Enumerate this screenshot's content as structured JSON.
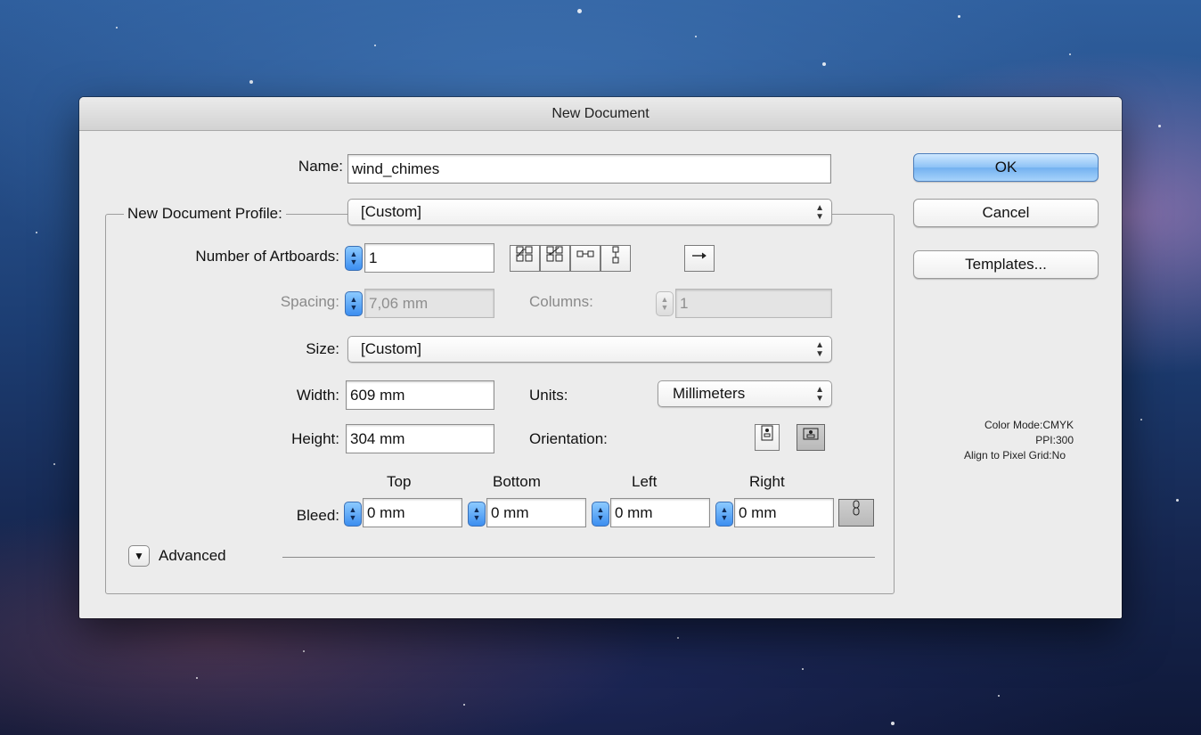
{
  "dialog": {
    "title": "New Document"
  },
  "name": {
    "label": "Name:",
    "value": "wind_chimes"
  },
  "profile": {
    "label": "New Document Profile:",
    "value": "[Custom]"
  },
  "artboards": {
    "label": "Number of Artboards:",
    "value": "1"
  },
  "spacing": {
    "label": "Spacing:",
    "value": "7,06 mm"
  },
  "columns": {
    "label": "Columns:",
    "value": "1"
  },
  "size": {
    "label": "Size:",
    "value": "[Custom]"
  },
  "width": {
    "label": "Width:",
    "value": "609 mm"
  },
  "height": {
    "label": "Height:",
    "value": "304 mm"
  },
  "units": {
    "label": "Units:",
    "value": "Millimeters"
  },
  "orientation": {
    "label": "Orientation:",
    "selected": "landscape"
  },
  "bleed": {
    "label": "Bleed:",
    "headers": [
      "Top",
      "Bottom",
      "Left",
      "Right"
    ],
    "values": [
      "0 mm",
      "0 mm",
      "0 mm",
      "0 mm"
    ]
  },
  "advanced": {
    "label": "Advanced"
  },
  "buttons": {
    "ok": "OK",
    "cancel": "Cancel",
    "templates": "Templates..."
  },
  "info": {
    "color_mode_label": "Color Mode:",
    "color_mode_value": "CMYK",
    "ppi_label": "PPI:",
    "ppi_value": "300",
    "align_label": "Align to Pixel Grid:",
    "align_value": "No"
  },
  "icons": {
    "grid_by_row": "grid-by-row-icon",
    "grid_by_column": "grid-by-column-icon",
    "arrange_by_row": "arrange-by-row-icon",
    "arrange_by_column": "arrange-by-column-icon",
    "layout_direction": "right-arrow-icon",
    "portrait": "portrait-orientation-icon",
    "landscape": "landscape-orientation-icon",
    "link": "link-bleed-icon"
  },
  "colors": {
    "accent": "#5aa2ee",
    "dialog_bg": "#ececec"
  }
}
